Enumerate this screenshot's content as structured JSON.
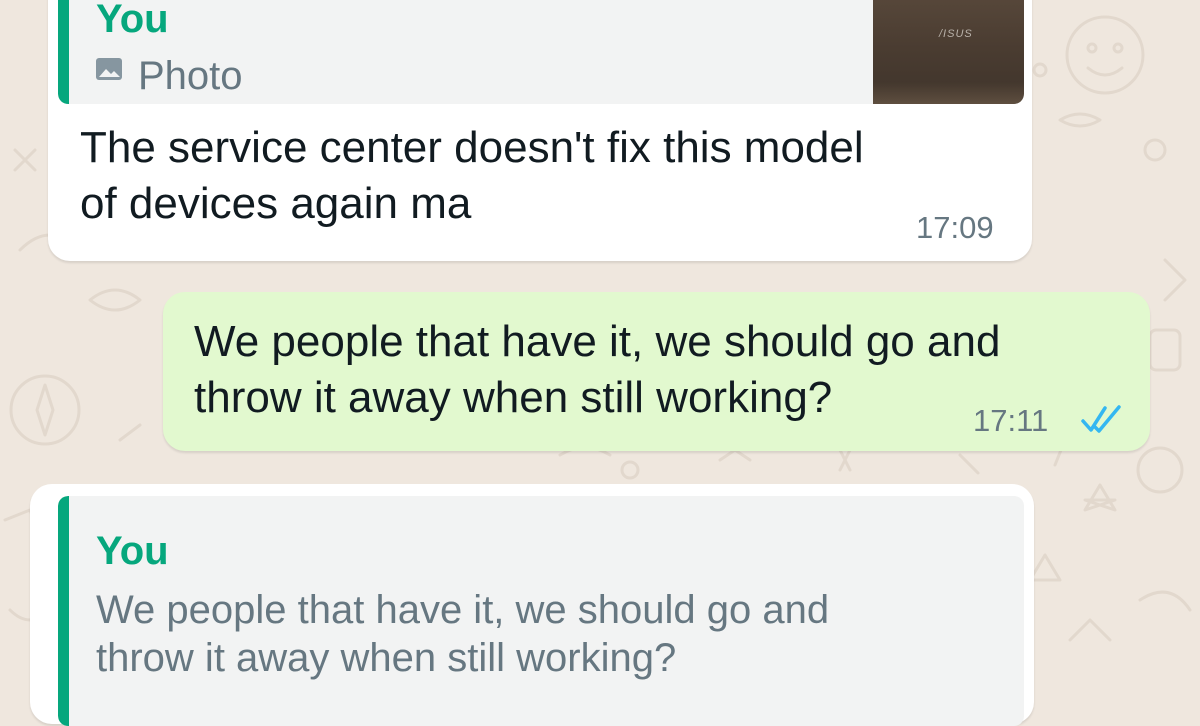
{
  "messages": [
    {
      "quote": {
        "author": "You",
        "icon": "photo-icon",
        "label": "Photo",
        "thumb_text": "/ISUS"
      },
      "text_lines": [
        "The service center doesn't fix this model",
        "of devices again ma"
      ],
      "time": "17:09"
    },
    {
      "text_lines": [
        "We people that have it, we should go and",
        "throw it away when still working?"
      ],
      "time": "17:11",
      "status_icon": "double-check-read-icon"
    },
    {
      "quote": {
        "author": "You",
        "text_lines": [
          "We people that have it, we should go and",
          "throw it away when still working?"
        ]
      }
    }
  ],
  "colors": {
    "wallpaper": "#efe7de",
    "incoming_bubble": "#ffffff",
    "outgoing_bubble": "#dcf8c6",
    "quote_accent": "#06a77d",
    "read_ticks": "#34b7f1",
    "timestamp": "#667781"
  }
}
